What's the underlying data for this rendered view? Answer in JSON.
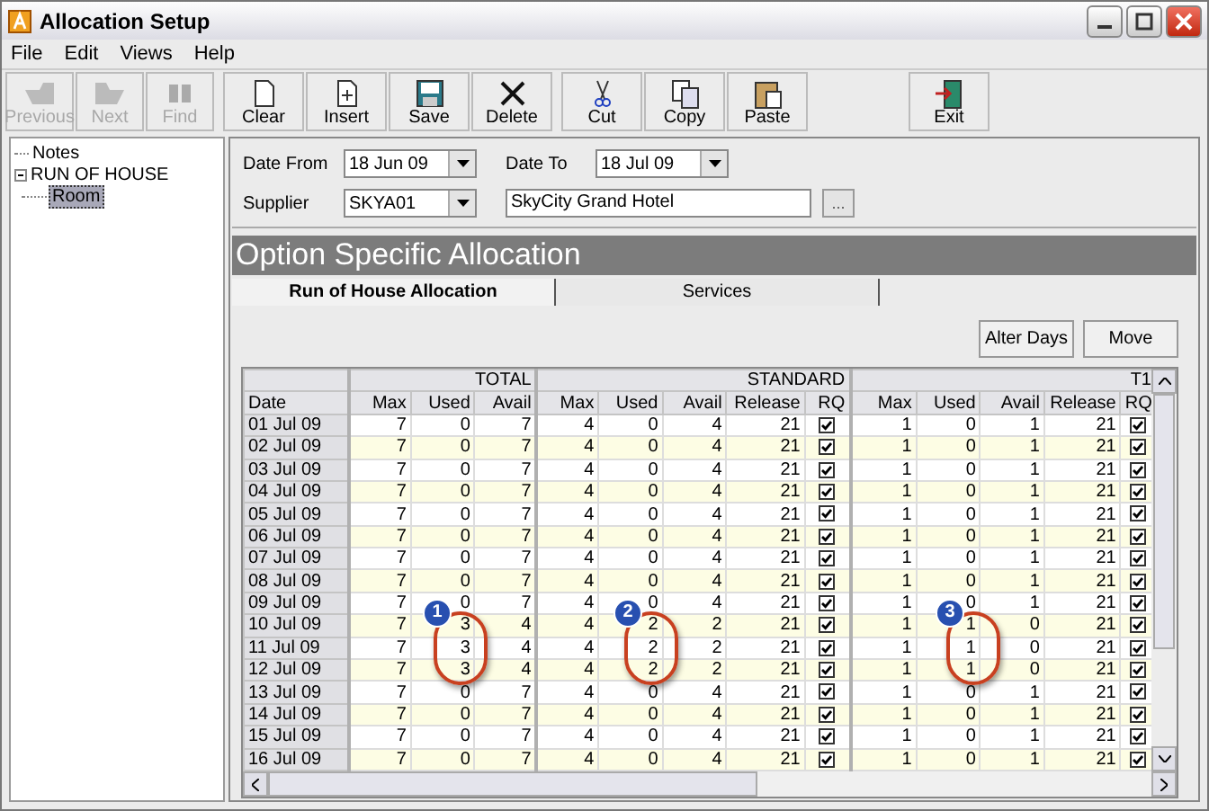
{
  "window": {
    "title": "Allocation Setup"
  },
  "menu": [
    "File",
    "Edit",
    "Views",
    "Help"
  ],
  "toolbar": [
    {
      "label": "Previous",
      "kind": "previous",
      "disabled": true
    },
    {
      "label": "Next",
      "kind": "next",
      "disabled": true
    },
    {
      "label": "Find",
      "kind": "find",
      "disabled": true
    },
    {
      "label": "Clear",
      "kind": "clear",
      "disabled": false
    },
    {
      "label": "Insert",
      "kind": "insert",
      "disabled": false
    },
    {
      "label": "Save",
      "kind": "save",
      "disabled": false
    },
    {
      "label": "Delete",
      "kind": "delete",
      "disabled": false
    },
    {
      "label": "Cut",
      "kind": "cut",
      "disabled": false
    },
    {
      "label": "Copy",
      "kind": "copy",
      "disabled": false
    },
    {
      "label": "Paste",
      "kind": "paste",
      "disabled": false
    },
    {
      "label": "Exit",
      "kind": "exit",
      "disabled": false
    }
  ],
  "tree": [
    {
      "label": "Notes",
      "selected": false
    },
    {
      "label": "RUN OF HOUSE",
      "selected": false,
      "expanded": true,
      "children": [
        {
          "label": "Room",
          "selected": true
        }
      ]
    }
  ],
  "filters": {
    "date_from": {
      "label": "Date From",
      "value": "18 Jun 09"
    },
    "date_to": {
      "label": "Date To",
      "value": "18 Jul 09"
    },
    "supplier": {
      "label": "Supplier",
      "value": "SKYA01"
    },
    "supplier_name": "SkyCity Grand Hotel",
    "browse_button": "..."
  },
  "section_title": "Option Specific Allocation",
  "tabs": [
    {
      "label": "Run of House Allocation",
      "selected": true
    },
    {
      "label": "Services",
      "selected": false
    }
  ],
  "actions": [
    "Alter Days",
    "Move"
  ],
  "grid": {
    "date_column": "Date",
    "groups": [
      {
        "label": "TOTAL",
        "columns": [
          "Max",
          "Used",
          "Avail"
        ]
      },
      {
        "label": "STANDARD",
        "columns": [
          "Max",
          "Used",
          "Avail",
          "Release",
          "RQ"
        ]
      },
      {
        "label": "T1",
        "columns": [
          "Max",
          "Used",
          "Avail",
          "Release",
          "RQ"
        ]
      }
    ],
    "rows": [
      {
        "date": "01 Jul 09",
        "total": [
          "7",
          "0",
          "7"
        ],
        "standard": {
          "values": [
            "4",
            "0",
            "4",
            "21"
          ],
          "rq": true
        },
        "t1": {
          "values": [
            "1",
            "0",
            "1",
            "21"
          ],
          "rq": true
        }
      },
      {
        "date": "02 Jul 09",
        "total": [
          "7",
          "0",
          "7"
        ],
        "standard": {
          "values": [
            "4",
            "0",
            "4",
            "21"
          ],
          "rq": true
        },
        "t1": {
          "values": [
            "1",
            "0",
            "1",
            "21"
          ],
          "rq": true
        }
      },
      {
        "date": "03 Jul 09",
        "total": [
          "7",
          "0",
          "7"
        ],
        "standard": {
          "values": [
            "4",
            "0",
            "4",
            "21"
          ],
          "rq": true
        },
        "t1": {
          "values": [
            "1",
            "0",
            "1",
            "21"
          ],
          "rq": true
        }
      },
      {
        "date": "04 Jul 09",
        "total": [
          "7",
          "0",
          "7"
        ],
        "standard": {
          "values": [
            "4",
            "0",
            "4",
            "21"
          ],
          "rq": true
        },
        "t1": {
          "values": [
            "1",
            "0",
            "1",
            "21"
          ],
          "rq": true
        }
      },
      {
        "date": "05 Jul 09",
        "total": [
          "7",
          "0",
          "7"
        ],
        "standard": {
          "values": [
            "4",
            "0",
            "4",
            "21"
          ],
          "rq": true
        },
        "t1": {
          "values": [
            "1",
            "0",
            "1",
            "21"
          ],
          "rq": true
        }
      },
      {
        "date": "06 Jul 09",
        "total": [
          "7",
          "0",
          "7"
        ],
        "standard": {
          "values": [
            "4",
            "0",
            "4",
            "21"
          ],
          "rq": true
        },
        "t1": {
          "values": [
            "1",
            "0",
            "1",
            "21"
          ],
          "rq": true
        }
      },
      {
        "date": "07 Jul 09",
        "total": [
          "7",
          "0",
          "7"
        ],
        "standard": {
          "values": [
            "4",
            "0",
            "4",
            "21"
          ],
          "rq": true
        },
        "t1": {
          "values": [
            "1",
            "0",
            "1",
            "21"
          ],
          "rq": true
        }
      },
      {
        "date": "08 Jul 09",
        "total": [
          "7",
          "0",
          "7"
        ],
        "standard": {
          "values": [
            "4",
            "0",
            "4",
            "21"
          ],
          "rq": true
        },
        "t1": {
          "values": [
            "1",
            "0",
            "1",
            "21"
          ],
          "rq": true
        }
      },
      {
        "date": "09 Jul 09",
        "total": [
          "7",
          "0",
          "7"
        ],
        "standard": {
          "values": [
            "4",
            "0",
            "4",
            "21"
          ],
          "rq": true
        },
        "t1": {
          "values": [
            "1",
            "0",
            "1",
            "21"
          ],
          "rq": true
        }
      },
      {
        "date": "10 Jul 09",
        "total": [
          "7",
          "3",
          "4"
        ],
        "standard": {
          "values": [
            "4",
            "2",
            "2",
            "21"
          ],
          "rq": true
        },
        "t1": {
          "values": [
            "1",
            "1",
            "0",
            "21"
          ],
          "rq": true
        }
      },
      {
        "date": "11 Jul 09",
        "total": [
          "7",
          "3",
          "4"
        ],
        "standard": {
          "values": [
            "4",
            "2",
            "2",
            "21"
          ],
          "rq": true
        },
        "t1": {
          "values": [
            "1",
            "1",
            "0",
            "21"
          ],
          "rq": true
        }
      },
      {
        "date": "12 Jul 09",
        "total": [
          "7",
          "3",
          "4"
        ],
        "standard": {
          "values": [
            "4",
            "2",
            "2",
            "21"
          ],
          "rq": true
        },
        "t1": {
          "values": [
            "1",
            "1",
            "0",
            "21"
          ],
          "rq": true
        }
      },
      {
        "date": "13 Jul 09",
        "total": [
          "7",
          "0",
          "7"
        ],
        "standard": {
          "values": [
            "4",
            "0",
            "4",
            "21"
          ],
          "rq": true
        },
        "t1": {
          "values": [
            "1",
            "0",
            "1",
            "21"
          ],
          "rq": true
        }
      },
      {
        "date": "14 Jul 09",
        "total": [
          "7",
          "0",
          "7"
        ],
        "standard": {
          "values": [
            "4",
            "0",
            "4",
            "21"
          ],
          "rq": true
        },
        "t1": {
          "values": [
            "1",
            "0",
            "1",
            "21"
          ],
          "rq": true
        }
      },
      {
        "date": "15 Jul 09",
        "total": [
          "7",
          "0",
          "7"
        ],
        "standard": {
          "values": [
            "4",
            "0",
            "4",
            "21"
          ],
          "rq": true
        },
        "t1": {
          "values": [
            "1",
            "0",
            "1",
            "21"
          ],
          "rq": true
        }
      },
      {
        "date": "16 Jul 09",
        "total": [
          "7",
          "0",
          "7"
        ],
        "standard": {
          "values": [
            "4",
            "0",
            "4",
            "21"
          ],
          "rq": true
        },
        "t1": {
          "values": [
            "1",
            "0",
            "1",
            "21"
          ],
          "rq": true
        }
      }
    ]
  },
  "annotations": [
    {
      "label": "1"
    },
    {
      "label": "2"
    },
    {
      "label": "3"
    }
  ]
}
